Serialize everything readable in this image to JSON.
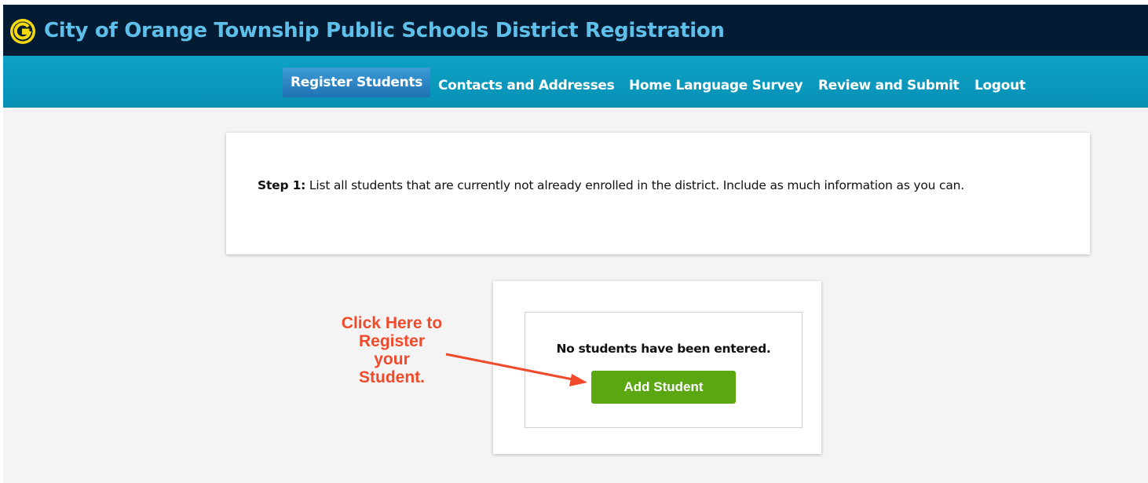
{
  "header": {
    "title": "City of Orange Township Public Schools District Registration",
    "logo_icon": "district-g-logo-icon"
  },
  "nav": {
    "items": [
      {
        "label": "Register Students",
        "active": true
      },
      {
        "label": "Contacts and Addresses",
        "active": false
      },
      {
        "label": "Home Language Survey",
        "active": false
      },
      {
        "label": "Review and Submit",
        "active": false
      },
      {
        "label": "Logout",
        "active": false
      }
    ]
  },
  "step": {
    "label": "Step 1:",
    "text": " List all students that are currently not already enrolled in the district. Include as much information as you can."
  },
  "students": {
    "empty_message": "No students have been entered.",
    "add_button_label": "Add Student"
  },
  "annotation": {
    "lines": [
      "Click Here to",
      "Register",
      "your",
      "Student."
    ],
    "color": "#f04a2a"
  },
  "colors": {
    "topbar": "#031c33",
    "title": "#5ec0ea",
    "navbar": "#0ea2c6",
    "active_tab": "#2a86c6",
    "add_button": "#5aa712"
  }
}
